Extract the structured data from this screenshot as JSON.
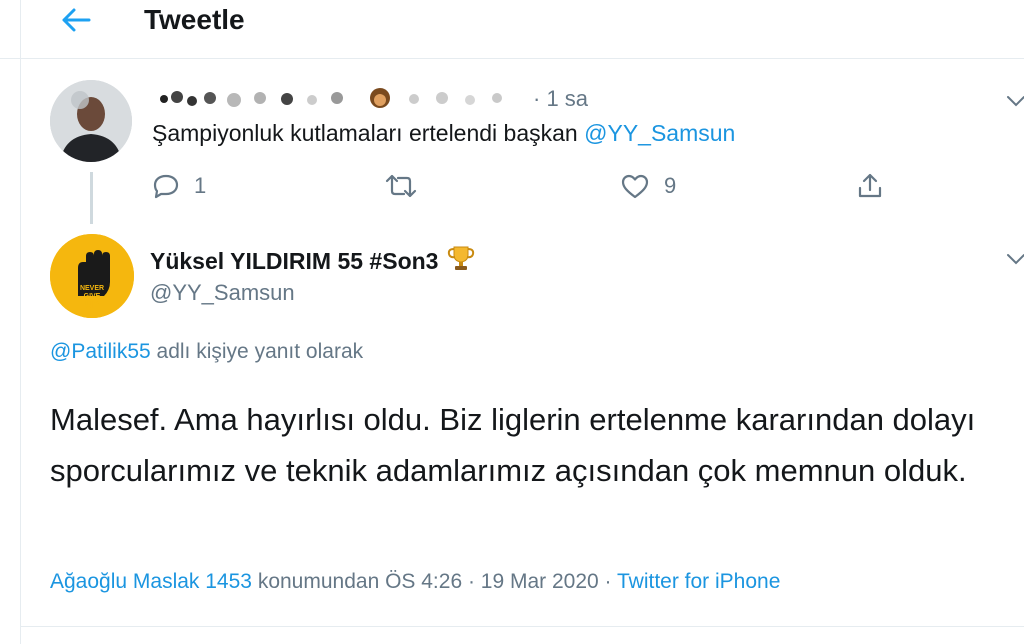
{
  "header": {
    "title": "Tweetle",
    "back_icon": "arrow-left-icon",
    "accent": "#1da1f2"
  },
  "parent_tweet": {
    "time": "· 1 sa",
    "text_prefix": "Şampiyonluk kutlamaları ertelendi başkan ",
    "mention": "@YY_Samsun",
    "actions": {
      "reply_count": "1",
      "retweet_count": "",
      "like_count": "9"
    }
  },
  "main_tweet": {
    "author_name": "Yüksel YILDIRIM 55 #Son3",
    "author_handle": "@YY_Samsun",
    "avatar_text": [
      "NEVER",
      "GIVE",
      "UP"
    ],
    "reply_mention": "@Patilik55",
    "reply_suffix": " adlı kişiye yanıt olarak",
    "body": "Malesef. Ama hayırlısı oldu. Biz liglerin ertelenme kararından dolayı sporcularımız ve teknik adamlarımız açısından çok memnun olduk.",
    "location": "Ağaoğlu Maslak 1453",
    "location_suffix": " konumundan ÖS 4:26 · 19 Mar 2020 · ",
    "source": "Twitter for iPhone"
  },
  "colors": {
    "link": "#1b95e0",
    "secondary_text": "#657786",
    "primary_text": "#14171a",
    "avatar_yellow": "#f5b70e"
  }
}
